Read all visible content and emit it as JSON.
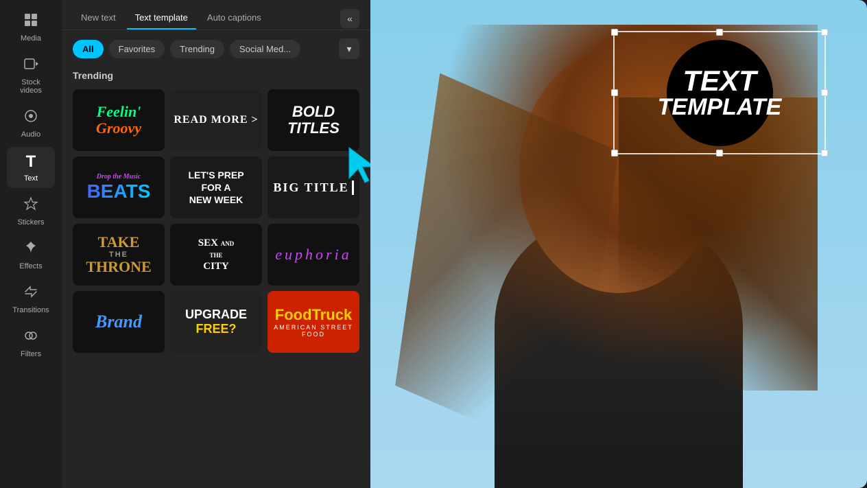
{
  "sidebar": {
    "items": [
      {
        "id": "media",
        "label": "Media",
        "icon": "▦"
      },
      {
        "id": "stock-videos",
        "label": "Stock videos",
        "icon": "⊞"
      },
      {
        "id": "audio",
        "label": "Audio",
        "icon": "♪"
      },
      {
        "id": "text",
        "label": "Text",
        "icon": "T",
        "active": true
      },
      {
        "id": "stickers",
        "label": "Stickers",
        "icon": "✦"
      },
      {
        "id": "effects",
        "label": "Effects",
        "icon": "✴"
      },
      {
        "id": "transitions",
        "label": "Transitions",
        "icon": "⊠"
      },
      {
        "id": "filters",
        "label": "Filters",
        "icon": "⊕"
      }
    ]
  },
  "panel": {
    "tabs": [
      {
        "id": "new-text",
        "label": "New text"
      },
      {
        "id": "text-template",
        "label": "Text template",
        "active": true
      },
      {
        "id": "auto-captions",
        "label": "Auto captions"
      }
    ],
    "more_icon": "«",
    "filters": [
      {
        "id": "all",
        "label": "All",
        "active": true
      },
      {
        "id": "favorites",
        "label": "Favorites"
      },
      {
        "id": "trending",
        "label": "Trending"
      },
      {
        "id": "social-media",
        "label": "Social Med..."
      }
    ],
    "dropdown_icon": "▾",
    "trending_title": "Trending",
    "templates": [
      {
        "id": "groovy",
        "label": "Feelin' Groovy",
        "type": "groovy"
      },
      {
        "id": "readmore",
        "label": "READ MORE >",
        "type": "readmore"
      },
      {
        "id": "bold",
        "label": "BOLD TITLES",
        "type": "bold"
      },
      {
        "id": "beats",
        "label": "Drop the Music BEATS",
        "type": "beats"
      },
      {
        "id": "prep",
        "label": "LET'S PREP FOR A NEW WEEK",
        "type": "prep"
      },
      {
        "id": "bigtitle",
        "label": "BIG TITLE",
        "type": "bigtitle"
      },
      {
        "id": "throne",
        "label": "TAKE THE THRONE",
        "type": "throne"
      },
      {
        "id": "satc",
        "label": "SEX AND THE CITY",
        "type": "satc"
      },
      {
        "id": "euphoria",
        "label": "EUPHORIA",
        "type": "euphoria"
      },
      {
        "id": "brand",
        "label": "Brand",
        "type": "brand"
      },
      {
        "id": "upgrade",
        "label": "UPGRADE FREE?",
        "type": "upgrade"
      },
      {
        "id": "food",
        "label": "FoodTruck",
        "type": "food"
      }
    ]
  },
  "canvas": {
    "text_template_line1": "TEXT",
    "text_template_line2": "TEMPLATE"
  }
}
